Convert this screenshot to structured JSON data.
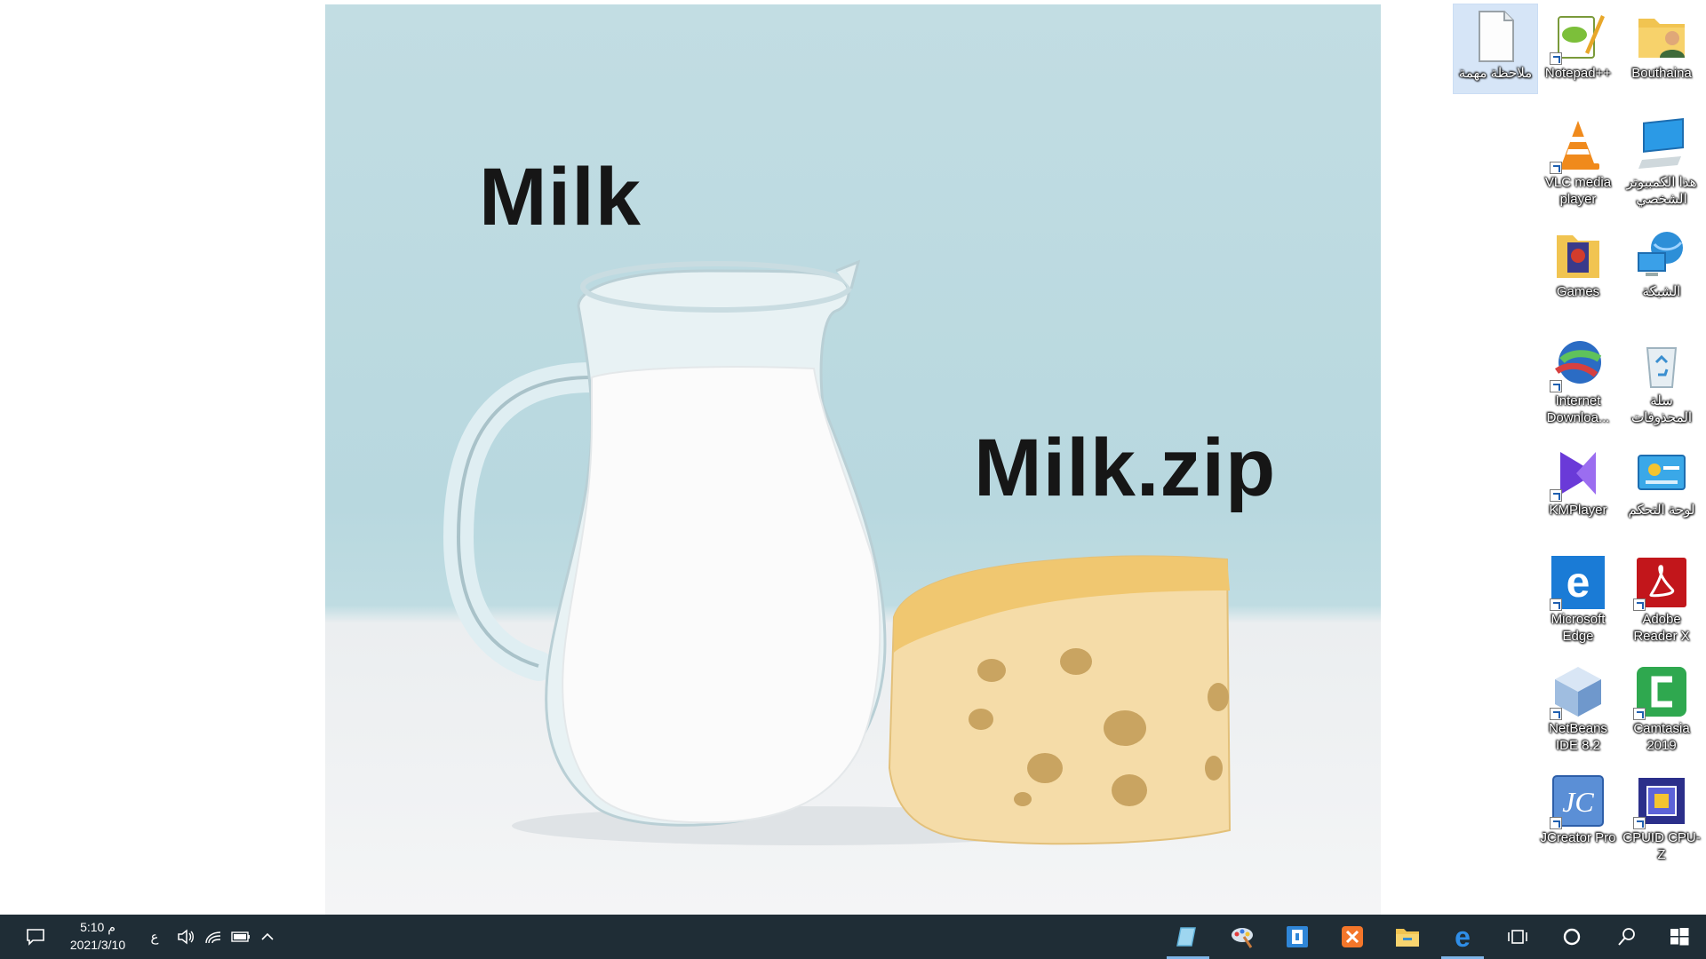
{
  "wallpaper": {
    "caption_top": "Milk",
    "caption_bottom": "Milk.zip"
  },
  "desktop_icons": [
    {
      "label": "ملاحظة مهمة",
      "icon": "text-document-icon",
      "selected": true
    },
    {
      "label": "Notepad++",
      "icon": "notepad-plus-plus-icon"
    },
    {
      "label": "Bouthaina",
      "icon": "user-folder-icon"
    },
    {
      "label": "VLC media player",
      "icon": "vlc-cone-icon"
    },
    {
      "label": "هذا الكمبيوتر الشخصي",
      "icon": "this-pc-icon"
    },
    {
      "label": "Games",
      "icon": "games-folder-icon"
    },
    {
      "label": "الشبكة",
      "icon": "network-icon"
    },
    {
      "label": "Internet Downloa...",
      "icon": "internet-download-manager-icon"
    },
    {
      "label": "سلة المحذوفات",
      "icon": "recycle-bin-icon"
    },
    {
      "label": "KMPlayer",
      "icon": "kmplayer-icon"
    },
    {
      "label": "لوحة التحكم",
      "icon": "control-panel-icon"
    },
    {
      "label": "Microsoft Edge",
      "icon": "edge-icon"
    },
    {
      "label": "Adobe Reader X",
      "icon": "adobe-reader-icon"
    },
    {
      "label": "NetBeans IDE 8.2",
      "icon": "netbeans-cube-icon"
    },
    {
      "label": "Camtasia 2019",
      "icon": "camtasia-icon"
    },
    {
      "label": "JCreator Pro",
      "icon": "jcreator-icon"
    },
    {
      "label": "CPUID CPU-Z",
      "icon": "cpu-z-icon"
    }
  ],
  "taskbar": {
    "time": "5:10 م",
    "date": "2021/3/10",
    "input_language": "ع",
    "pinned": [
      "notes-app-icon",
      "paint-app-icon",
      "snipping-app-icon",
      "xampp-icon",
      "file-explorer-icon",
      "edge-icon",
      "task-view-icon",
      "cortana-icon",
      "search-icon",
      "start-windows-icon"
    ]
  },
  "colors": {
    "taskbar_bg": "#1f2d36",
    "accent_underline": "#7fb5e8",
    "sky": "#b8d8df"
  }
}
